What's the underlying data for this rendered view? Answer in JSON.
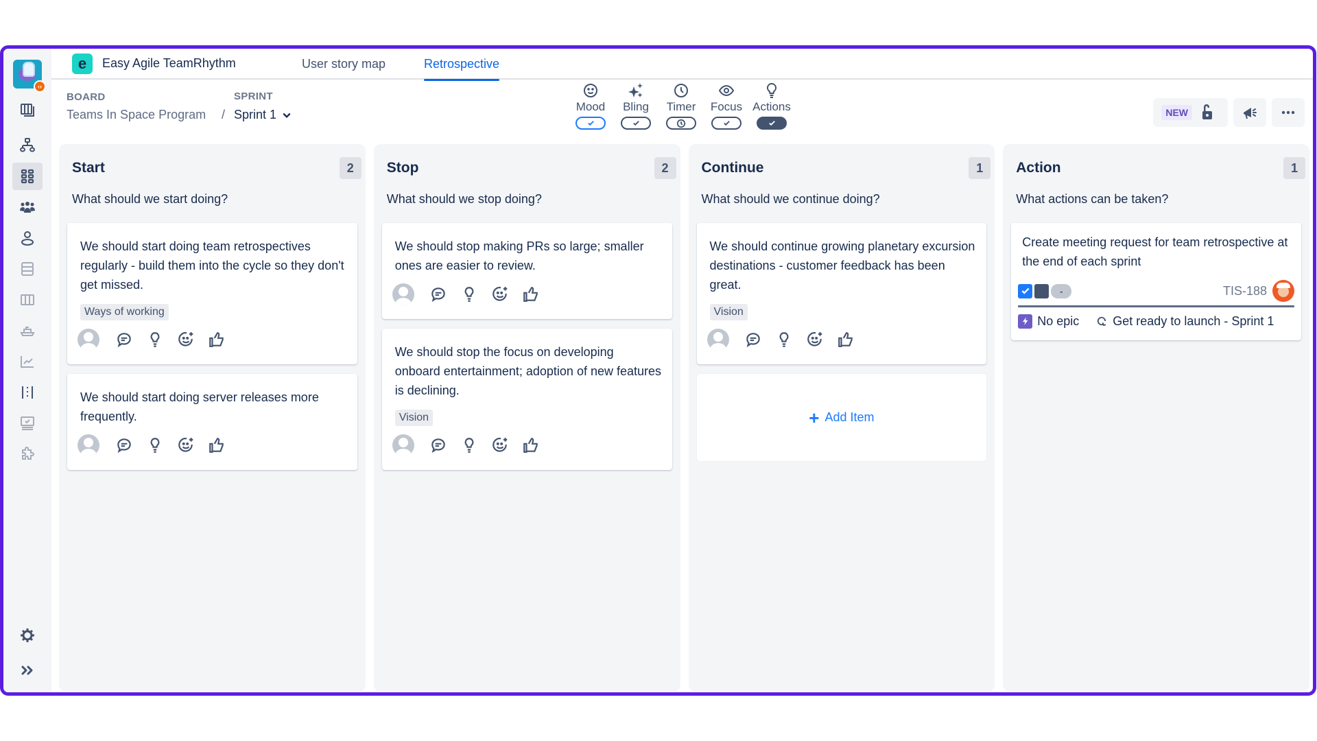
{
  "app": {
    "name": "Easy Agile TeamRhythm",
    "logo_letter": "e",
    "tabs": [
      {
        "label": "User story map",
        "active": false
      },
      {
        "label": "Retrospective",
        "active": true
      }
    ]
  },
  "breadcrumb": {
    "board_label": "BOARD",
    "board_value": "Teams In Space Program",
    "separator": "/",
    "sprint_label": "SPRINT",
    "sprint_value": "Sprint 1"
  },
  "sidebar": {
    "items": [
      {
        "icon": "board-icon",
        "active": false
      },
      {
        "icon": "hierarchy-icon",
        "active": false
      },
      {
        "icon": "grid-icon",
        "active": true
      },
      {
        "icon": "team-icon",
        "active": false
      },
      {
        "icon": "person-icon",
        "active": false
      },
      {
        "icon": "backlog-icon",
        "active": false
      },
      {
        "icon": "columns-icon",
        "active": false
      },
      {
        "icon": "ship-icon",
        "active": false
      },
      {
        "icon": "chart-icon",
        "active": false
      },
      {
        "icon": "timeline-icon",
        "active": false
      },
      {
        "icon": "monitor-icon",
        "active": false
      },
      {
        "icon": "puzzle-icon",
        "active": false
      }
    ],
    "bottom": [
      {
        "icon": "gear-icon"
      },
      {
        "icon": "expand-icon"
      }
    ]
  },
  "toolbar": {
    "tools": [
      {
        "label": "Mood",
        "icon": "smiley-icon",
        "toggle": "check",
        "state": "focused"
      },
      {
        "label": "Bling",
        "icon": "sparkle-icon",
        "toggle": "check",
        "state": "off"
      },
      {
        "label": "Timer",
        "icon": "clock-icon",
        "toggle": "clock",
        "state": "off"
      },
      {
        "label": "Focus",
        "icon": "eye-icon",
        "toggle": "check",
        "state": "off"
      },
      {
        "label": "Actions",
        "icon": "lightbulb-icon",
        "toggle": "check",
        "state": "on"
      }
    ]
  },
  "header_actions": {
    "new_badge": "NEW",
    "lock_icon": "unlock-icon",
    "announce_icon": "megaphone-icon",
    "more_icon": "more-icon"
  },
  "colors": {
    "frame": "#5b1ee0",
    "accent": "#0c66e4",
    "column_bg": "#f4f5f7",
    "text": "#172b4d"
  },
  "columns": [
    {
      "title": "Start",
      "count": "2",
      "prompt": "What should we start doing?",
      "cards": [
        {
          "text": "We should start doing team retrospectives regularly - build them into the cycle so they don't get missed.",
          "label": "Ways of working"
        },
        {
          "text": "We should start doing server releases more frequently.",
          "label": null
        }
      ]
    },
    {
      "title": "Stop",
      "count": "2",
      "prompt": "What should we stop doing?",
      "cards": [
        {
          "text": "We should stop making PRs so large; smaller ones are easier to review.",
          "label": null
        },
        {
          "text": "We should stop the focus on developing onboard entertainment; adoption of new features is declining.",
          "label": "Vision"
        }
      ]
    },
    {
      "title": "Continue",
      "count": "1",
      "prompt": "What should we continue doing?",
      "cards": [
        {
          "text": "We should continue growing planetary excursion destinations - customer feedback has been great.",
          "label": "Vision"
        }
      ],
      "add_item": "Add Item"
    },
    {
      "title": "Action",
      "count": "1",
      "prompt": "What actions can be taken?",
      "action_card": {
        "text": "Create meeting request for team retrospective at the end of each sprint",
        "status_pill": "-",
        "issue_key": "TIS-188",
        "epic": "No epic",
        "sprint": "Get ready to launch - Sprint 1"
      }
    }
  ]
}
